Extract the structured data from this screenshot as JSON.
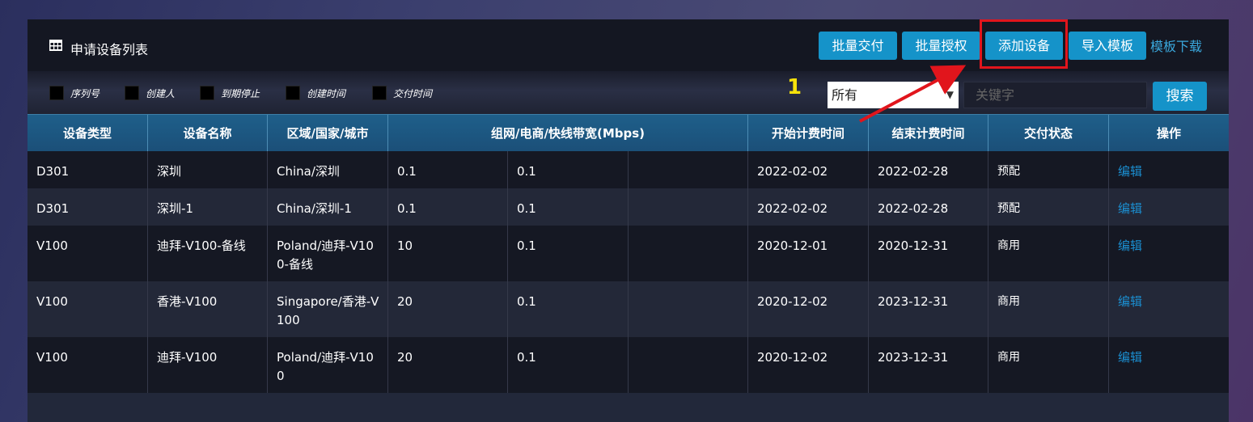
{
  "header": {
    "title": "申请设备列表",
    "buttons": [
      "批量交付",
      "批量授权",
      "添加设备",
      "导入模板"
    ],
    "download_link": "模板下载"
  },
  "annotation": {
    "step_number": "1"
  },
  "filters": {
    "checkbox_labels": [
      "序列号",
      "创建人",
      "到期停止",
      "创建时间",
      "交付时间"
    ],
    "select_value": "所有",
    "search_placeholder": "关键字",
    "search_button": "搜索"
  },
  "table": {
    "columns": [
      "设备类型",
      "设备名称",
      "区域/国家/城市",
      "组网/电商/快线带宽(Mbps)",
      "开始计费时间",
      "结束计费时间",
      "交付状态",
      "操作"
    ],
    "rows": [
      {
        "type": "D301",
        "name": "深圳",
        "region": "China/深圳",
        "bw1": "0.1",
        "bw2": "0.1",
        "bw3": "",
        "start": "2022-02-02",
        "end": "2022-02-28",
        "status": "预配",
        "action": "编辑"
      },
      {
        "type": "D301",
        "name": "深圳-1",
        "region": "China/深圳-1",
        "bw1": "0.1",
        "bw2": "0.1",
        "bw3": "",
        "start": "2022-02-02",
        "end": "2022-02-28",
        "status": "预配",
        "action": "编辑"
      },
      {
        "type": "V100",
        "name": "迪拜-V100-备线",
        "region": "Poland/迪拜-V100-备线",
        "bw1": "10",
        "bw2": "0.1",
        "bw3": "",
        "start": "2020-12-01",
        "end": "2020-12-31",
        "status": "商用",
        "action": "编辑"
      },
      {
        "type": "V100",
        "name": "香港-V100",
        "region": "Singapore/香港-V100",
        "bw1": "20",
        "bw2": "0.1",
        "bw3": "",
        "start": "2020-12-02",
        "end": "2023-12-31",
        "status": "商用",
        "action": "编辑"
      },
      {
        "type": "V100",
        "name": "迪拜-V100",
        "region": "Poland/迪拜-V100",
        "bw1": "20",
        "bw2": "0.1",
        "bw3": "",
        "start": "2020-12-02",
        "end": "2023-12-31",
        "status": "商用",
        "action": "编辑"
      }
    ]
  },
  "colors": {
    "accent": "#1593c9",
    "highlight": "#e1151c",
    "annotation": "#f7e20b"
  }
}
